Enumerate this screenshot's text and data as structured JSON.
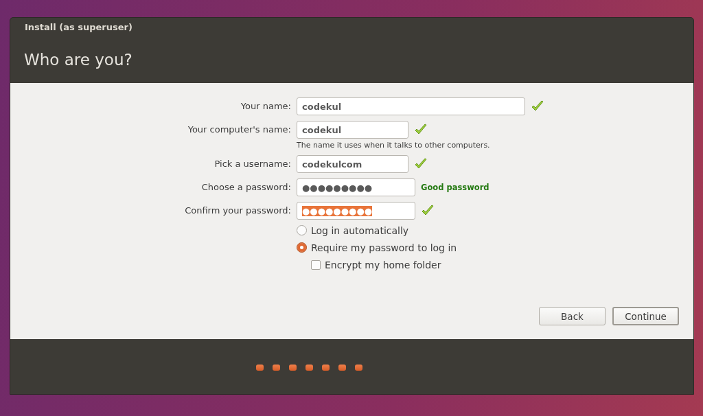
{
  "window": {
    "title": "Install (as superuser)"
  },
  "header": {
    "title": "Who are you?"
  },
  "fields": [
    {
      "kind": "name",
      "label": "Your name:",
      "value": "codekul",
      "valid": true
    },
    {
      "kind": "text",
      "label": "Your computer's name:",
      "value": "codekul",
      "valid": true,
      "hint": "The name it uses when it talks to other computers."
    },
    {
      "kind": "text",
      "label": "Pick a username:",
      "value": "codekulcom",
      "valid": true
    },
    {
      "kind": "password",
      "label": "Choose a password:",
      "value": "●●●●●●●●●",
      "valid": false,
      "selected": false,
      "strength": "Good password"
    },
    {
      "kind": "password",
      "label": "Confirm your password:",
      "value": "●●●●●●●●●",
      "valid": true,
      "selected": true
    }
  ],
  "login_options": [
    {
      "label": "Log in automatically",
      "selected": false
    },
    {
      "label": "Require my password to log in",
      "selected": true
    }
  ],
  "encrypt": {
    "label": "Encrypt my home folder",
    "checked": false
  },
  "buttons": [
    {
      "label": "Back",
      "default": false
    },
    {
      "label": "Continue",
      "default": true
    }
  ]
}
